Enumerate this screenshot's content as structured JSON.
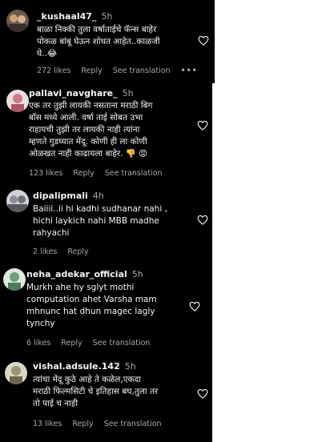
{
  "comments": [
    {
      "username": "_kushaal47_",
      "time": "5h",
      "lines": [
        "बाळा निक्की तुला वर्षाताईचे फॅन्स बाहेर",
        "पोकळ बांबू घेऊन शोधत आहेत..काळजी",
        "घे..😂"
      ],
      "likes": "272 likes",
      "reply": "Reply",
      "translate": "See translation",
      "more": "•••",
      "avatar_color": "#c9a27a"
    },
    {
      "username": "pallavi_navghare_",
      "time": "5h",
      "lines": [
        "एक तर तुझी लायकी नसताना मराठी बिग",
        "बॉस मध्ये आली. वर्षा ताई सोबत उभा",
        "राहायची तुझी तर लायकी नाही त्यांना",
        "म्हणते गुडघ्यात मेंदू. कोणी ही ला कोणी",
        "ओळखत नाही काढायला बाहेर. 👎 😡"
      ],
      "likes": "123 likes",
      "reply": "Reply",
      "translate": "See translation",
      "more": "",
      "avatar_color": "#d07a86"
    },
    {
      "username": "dipalipmali",
      "time": "4h",
      "lines": [
        "Baiiii..ii hi kadhi sudhanar nahi ,",
        "hichi laykich nahi MBB madhe",
        "rahyachi"
      ],
      "likes": "2 likes",
      "reply": "Reply",
      "translate": "",
      "more": "",
      "avatar_color": "#8a8f96"
    },
    {
      "username": "neha_adekar_official",
      "time": "5h",
      "lines": [
        "Murkh ahe hy sglyt mothi",
        "computation ahet Varsha mam",
        "mhnunc hat dhun magec lagly",
        "tynchy"
      ],
      "likes": "6 likes",
      "reply": "Reply",
      "translate": "See translation",
      "more": "",
      "avatar_color": "#6f9e78"
    },
    {
      "username": "vishal.adsule.142",
      "time": "5h",
      "lines": [
        "त्यांचा मेंदू कुठे आहे ते कळेल,एकदा",
        "मराठी फिल्मसिटी चे इतिहास बघ,तुला तर",
        "तो पाई च नाही"
      ],
      "likes": "13 likes",
      "reply": "Reply",
      "translate": "See translation",
      "more": "",
      "avatar_color": "#9b9470"
    }
  ]
}
